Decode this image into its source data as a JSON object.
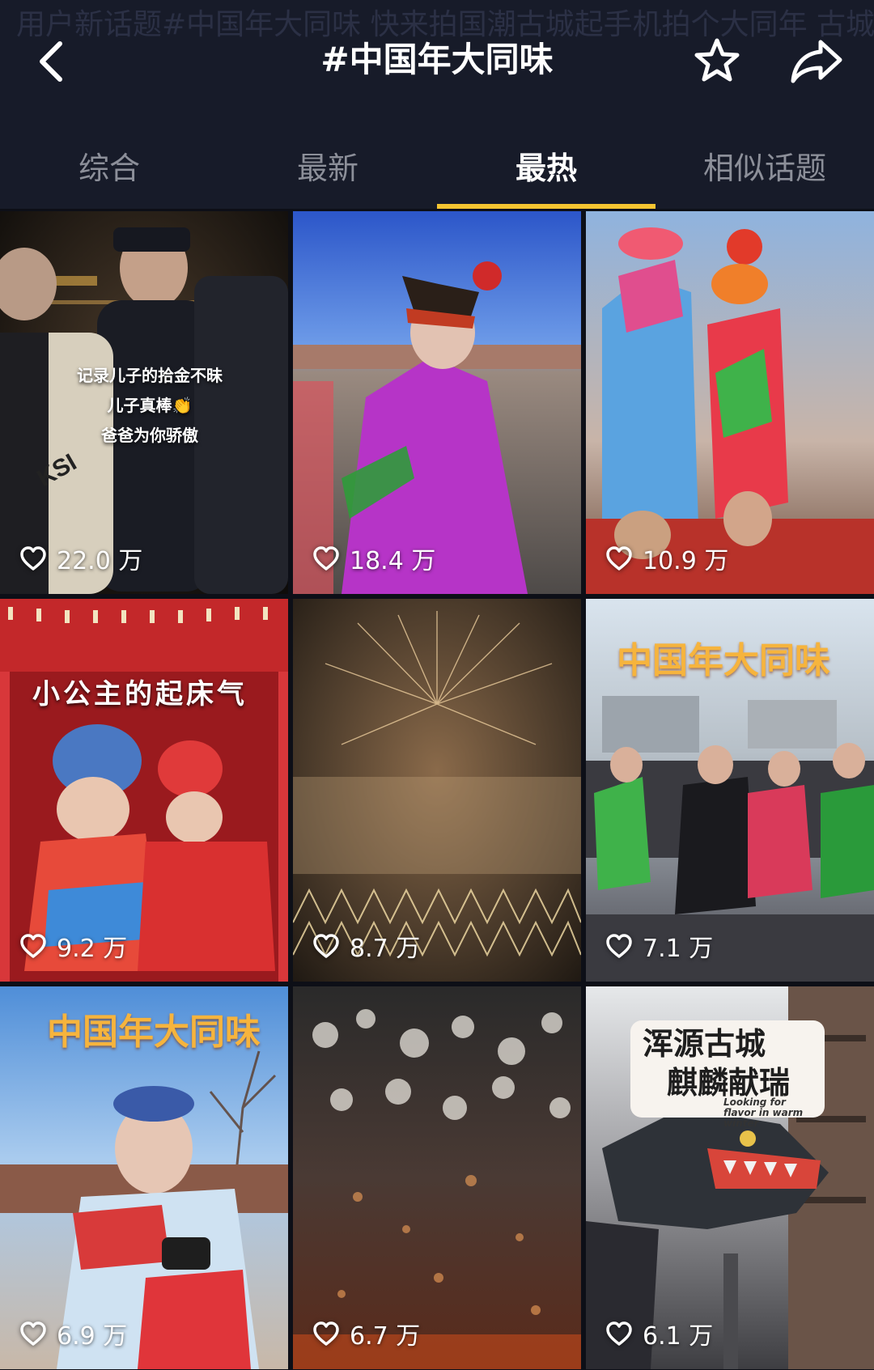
{
  "header": {
    "title": "#中国年大同味",
    "background_text": "用户新话题#中国年大同味   快来拍国潮古城起手机拍个大同年   古城   拼搭运动   古城   南方城   展示"
  },
  "tabs": [
    {
      "label": "综合",
      "active": false
    },
    {
      "label": "最新",
      "active": false
    },
    {
      "label": "最热",
      "active": true
    },
    {
      "label": "相似话题",
      "active": false
    }
  ],
  "colors": {
    "accent": "#f5c531",
    "header_bg": "#171b29",
    "page_bg": "#0d0f17"
  },
  "icons": {
    "back": "chevron-left-icon",
    "favorite": "star-outline-icon",
    "share": "share-arrow-icon",
    "like": "heart-outline-icon"
  },
  "videos": [
    {
      "likes": "22.0 万",
      "caption_lines": [
        "记录儿子的拾金不昧",
        "儿子真棒👏",
        "爸爸为你骄傲"
      ]
    },
    {
      "likes": "18.4 万"
    },
    {
      "likes": "10.9 万"
    },
    {
      "likes": "9.2 万",
      "caption": "小公主的起床气"
    },
    {
      "likes": "8.7 万"
    },
    {
      "likes": "7.1 万",
      "caption": "中国年大同味"
    },
    {
      "likes": "6.9 万",
      "caption": "中国年大同味"
    },
    {
      "likes": "6.7 万"
    },
    {
      "likes": "6.1 万",
      "caption_l1": "浑源古城",
      "caption_l2": "麒麟献瑞",
      "caption_l3": "Looking for flavor in warm winter"
    }
  ]
}
